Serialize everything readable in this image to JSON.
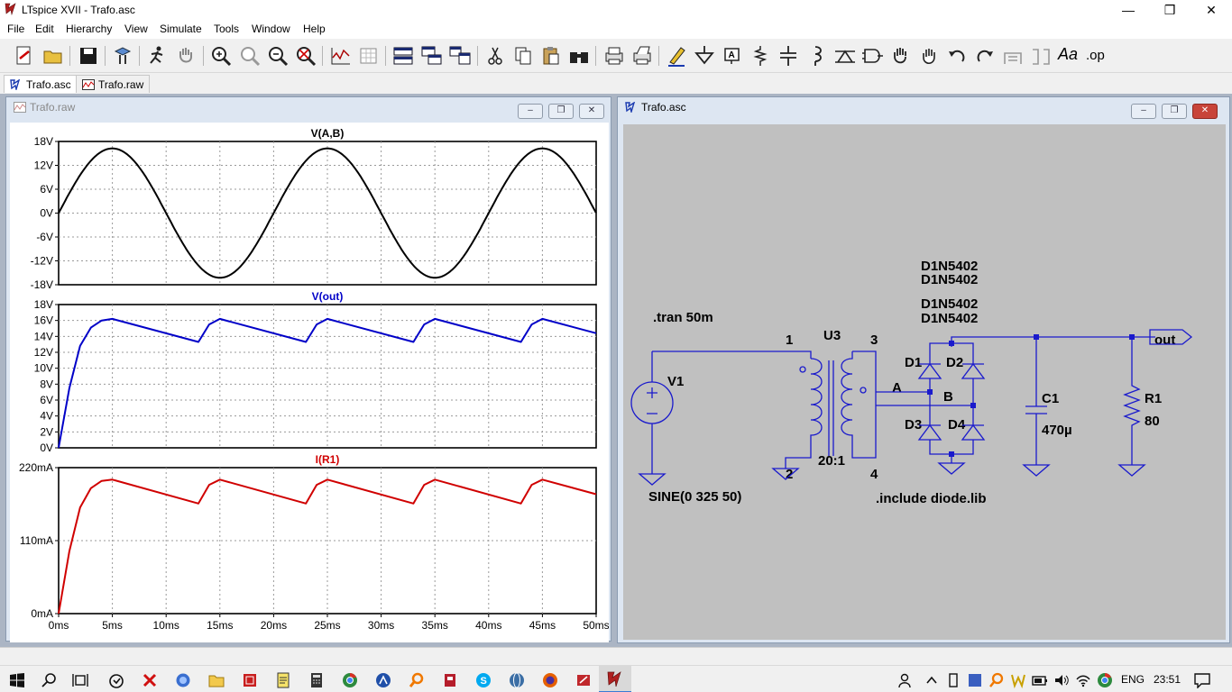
{
  "window": {
    "title": "LTspice XVII - Trafo.asc"
  },
  "menu": [
    "File",
    "Edit",
    "Hierarchy",
    "View",
    "Simulate",
    "Tools",
    "Window",
    "Help"
  ],
  "tabs": [
    {
      "label": "Trafo.asc",
      "active": true
    },
    {
      "label": "Trafo.raw",
      "active": false
    }
  ],
  "plot_window": {
    "title": "Trafo.raw"
  },
  "schematic_window": {
    "title": "Trafo.asc"
  },
  "toolbar": {
    "text_tool": "Aa",
    "op_tool": ".op"
  },
  "chart_data": [
    {
      "type": "line",
      "title": "V(A,B)",
      "color": "#000000",
      "ytick_labels": [
        "18V",
        "12V",
        "6V",
        "0V",
        "-6V",
        "-12V",
        "-18V"
      ],
      "ylim": [
        -18,
        18
      ],
      "xlim": [
        0,
        50
      ],
      "x": [
        0,
        2.5,
        5,
        7.5,
        10,
        12.5,
        15,
        17.5,
        20,
        22.5,
        25,
        27.5,
        30,
        32.5,
        35,
        37.5,
        40,
        42.5,
        45,
        47.5,
        50
      ],
      "values": [
        0,
        11.5,
        16.25,
        11.5,
        0,
        -11.5,
        -16.25,
        -11.5,
        0,
        11.5,
        16.25,
        11.5,
        0,
        -11.5,
        -16.25,
        -11.5,
        0,
        11.5,
        16.25,
        11.5,
        0
      ]
    },
    {
      "type": "line",
      "title": "V(out)",
      "color": "#0000c8",
      "ytick_labels": [
        "18V",
        "16V",
        "14V",
        "12V",
        "10V",
        "8V",
        "6V",
        "4V",
        "2V",
        "0V"
      ],
      "ylim": [
        0,
        18
      ],
      "xlim": [
        0,
        50
      ],
      "x": [
        0,
        1,
        2,
        3,
        4,
        5,
        13,
        14,
        15,
        23,
        24,
        25,
        33,
        34,
        35,
        43,
        44,
        45,
        50
      ],
      "values": [
        0,
        7.5,
        12.8,
        15.1,
        16.0,
        16.2,
        13.3,
        15.5,
        16.2,
        13.3,
        15.5,
        16.2,
        13.3,
        15.5,
        16.2,
        13.3,
        15.5,
        16.2,
        14.4
      ]
    },
    {
      "type": "line",
      "title": "I(R1)",
      "color": "#d00000",
      "ytick_labels": [
        "220mA",
        "110mA",
        "0mA"
      ],
      "ylim": [
        0,
        220
      ],
      "xlim": [
        0,
        50
      ],
      "xtick_labels": [
        "0ms",
        "5ms",
        "10ms",
        "15ms",
        "20ms",
        "25ms",
        "30ms",
        "35ms",
        "40ms",
        "45ms",
        "50ms"
      ],
      "x": [
        0,
        1,
        2,
        3,
        4,
        5,
        13,
        14,
        15,
        23,
        24,
        25,
        33,
        34,
        35,
        43,
        44,
        45,
        50
      ],
      "values": [
        0,
        94,
        160,
        189,
        200,
        202,
        166,
        194,
        202,
        166,
        194,
        202,
        166,
        194,
        202,
        166,
        194,
        202,
        180
      ]
    }
  ],
  "schematic": {
    "directive_tran": ".tran 50m",
    "directive_include": ".include diode.lib",
    "source": {
      "name": "V1",
      "value": "SINE(0 325 50)"
    },
    "transformer": {
      "name": "U3",
      "ratio": "20:1",
      "pins": [
        "1",
        "2",
        "3",
        "4"
      ]
    },
    "diode_models": [
      "D1N5402",
      "D1N5402",
      "D1N5402",
      "D1N5402"
    ],
    "diodes": [
      "D1",
      "D2",
      "D3",
      "D4"
    ],
    "nets": [
      "A",
      "B"
    ],
    "capacitor": {
      "name": "C1",
      "value": "470µ"
    },
    "resistor": {
      "name": "R1",
      "value": "80"
    },
    "output_label": "out"
  },
  "taskbar": {
    "language": "ENG",
    "time": "23:51"
  }
}
